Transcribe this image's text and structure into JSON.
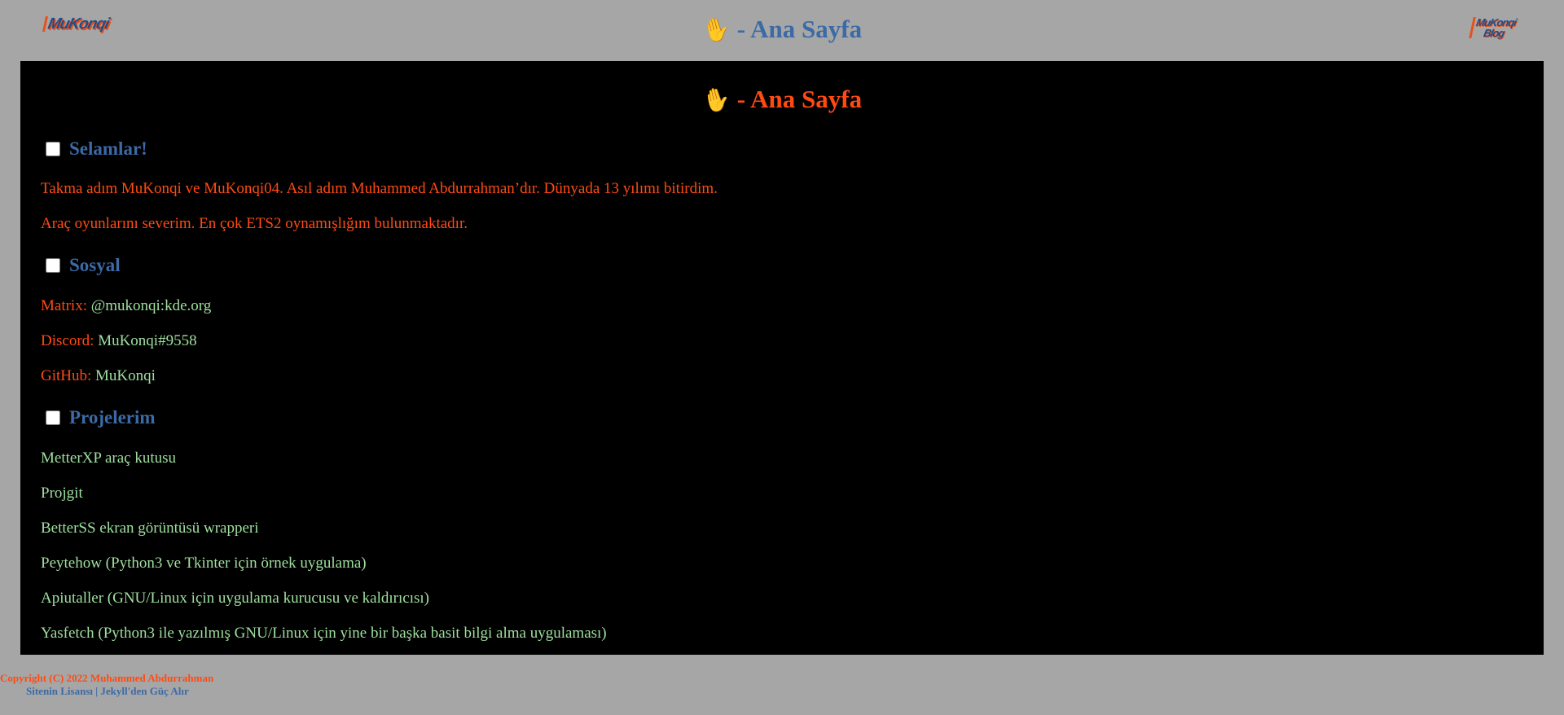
{
  "header": {
    "logo_left": "MuKonqi",
    "title": "- Ana Sayfa",
    "logo_right": [
      "MuKonqi",
      "Blog"
    ]
  },
  "main": {
    "title": "- Ana Sayfa",
    "sections": [
      {
        "heading": "Selamlar!",
        "lines": [
          "Takma adım MuKonqi ve MuKonqi04. Asıl adım Muhammed Abdurrahman’dır. Dünyada 13 yılımı bitirdim.",
          "Araç oyunlarını severim. En çok ETS2 oynamışlığım bulunmaktadır."
        ]
      },
      {
        "heading": "Sosyal",
        "links": [
          {
            "label": "Matrix:",
            "value": "@mukonqi:kde.org"
          },
          {
            "label": "Discord:",
            "value": "MuKonqi#9558"
          },
          {
            "label": "GitHub:",
            "value": "MuKonqi"
          }
        ]
      },
      {
        "heading": "Projelerim",
        "projects": [
          "MetterXP araç kutusu",
          "Projgit",
          "BetterSS ekran görüntüsü wrapperi",
          "Peytehow (Python3 ve Tkinter için örnek uygulama)",
          "Apiutaller (GNU/Linux için uygulama kurucusu ve kaldırıcısı)",
          "Yasfetch (Python3 ile yazılmış GNU/Linux için yine bir başka basit bilgi alma uygulaması)"
        ]
      }
    ]
  },
  "footer": {
    "copyright": "Copyright (C) 2022 Muhammed Abdurrahman",
    "license_link": "Sitenin Lisansı",
    "separator": "|",
    "jekyll_link": "Jekyll'den Güç Alır"
  },
  "colors": {
    "page_bg": "#a6a6a6",
    "panel_bg": "#000000",
    "accent_red": "#ff4a12",
    "accent_blue": "#3b6aa6",
    "text_green": "#9fe09f"
  },
  "icons": {
    "wave": "waving-hand-icon"
  }
}
